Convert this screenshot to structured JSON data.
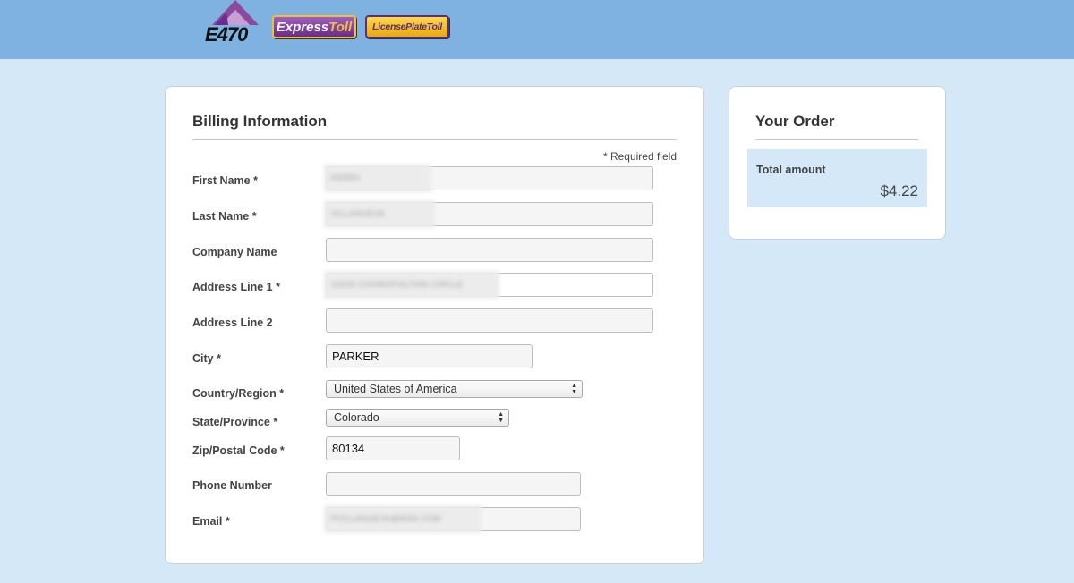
{
  "header": {
    "logos": {
      "e470": "E470",
      "express_main": "Express",
      "express_toll": "Toll",
      "license_plate_toll": "LicensePlateToll"
    },
    "colors": {
      "bar": "#7fb2e0",
      "page_bg": "#d4e8f7"
    }
  },
  "billing": {
    "title": "Billing Information",
    "required_note": "* Required field",
    "fields": {
      "first_name": {
        "label": "First Name *",
        "value": "PERRY"
      },
      "last_name": {
        "label": "Last Name *",
        "value": "VILLANUEVA"
      },
      "company_name": {
        "label": "Company Name",
        "value": ""
      },
      "address_line_1": {
        "label": "Address Line 1 *",
        "value": "10230 COSMOPOLITAN CIRCLE"
      },
      "address_line_2": {
        "label": "Address Line 2",
        "value": ""
      },
      "city": {
        "label": "City *",
        "value": "PARKER"
      },
      "country": {
        "label": "Country/Region *",
        "value": "United States of America"
      },
      "state": {
        "label": "State/Province *",
        "value": "Colorado"
      },
      "zip": {
        "label": "Zip/Postal Code *",
        "value": "80134"
      },
      "phone": {
        "label": "Phone Number",
        "value": ""
      },
      "email": {
        "label": "Email *",
        "value": "PVILLANUEVA@MSN.COM"
      }
    }
  },
  "order": {
    "title": "Your Order",
    "total_label": "Total amount",
    "total_value": "$4.22"
  }
}
